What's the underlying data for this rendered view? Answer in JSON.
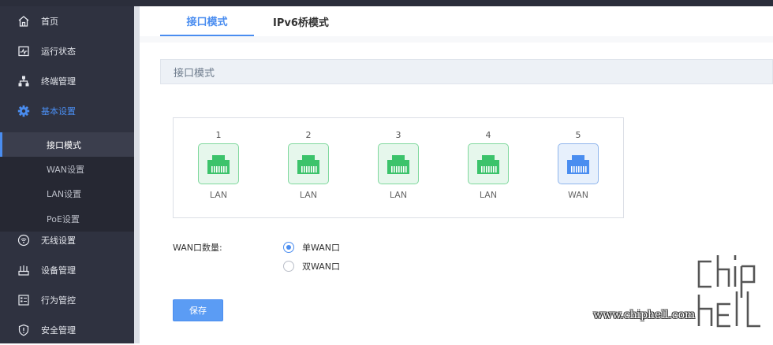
{
  "sidebar": {
    "items": [
      {
        "label": "首页",
        "icon": "home-icon"
      },
      {
        "label": "运行状态",
        "icon": "monitor-icon"
      },
      {
        "label": "终端管理",
        "icon": "network-icon"
      },
      {
        "label": "基本设置",
        "icon": "gear-icon"
      },
      {
        "label": "无线设置",
        "icon": "wifi-icon"
      },
      {
        "label": "设备管理",
        "icon": "device-icon"
      },
      {
        "label": "行为管控",
        "icon": "behavior-icon"
      },
      {
        "label": "安全管理",
        "icon": "shield-icon"
      }
    ],
    "sub_items": [
      {
        "label": "接口模式"
      },
      {
        "label": "WAN设置"
      },
      {
        "label": "LAN设置"
      },
      {
        "label": "PoE设置"
      }
    ]
  },
  "tabs": [
    {
      "label": "接口模式"
    },
    {
      "label": "IPv6桥模式"
    }
  ],
  "section": {
    "title": "接口模式"
  },
  "ports": [
    {
      "number": "1",
      "type": "LAN"
    },
    {
      "number": "2",
      "type": "LAN"
    },
    {
      "number": "3",
      "type": "LAN"
    },
    {
      "number": "4",
      "type": "LAN"
    },
    {
      "number": "5",
      "type": "WAN"
    }
  ],
  "wan_count": {
    "label": "WAN口数量:",
    "options": [
      {
        "label": "单WAN口",
        "checked": true
      },
      {
        "label": "双WAN口",
        "checked": false
      }
    ]
  },
  "save_label": "保存",
  "watermark": {
    "url": "www.chiphell.com",
    "logo": "chiphell-logo"
  },
  "colors": {
    "accent": "#4a8df0",
    "lan": "#3cc36b",
    "wan": "#4a8df0",
    "sidebar_bg": "#2f3240"
  }
}
